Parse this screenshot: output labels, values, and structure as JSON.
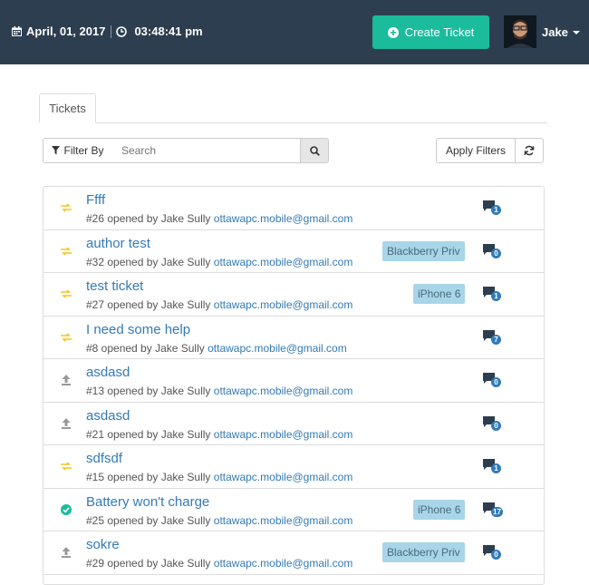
{
  "header": {
    "date": "April, 01, 2017",
    "time": "03:48:41 pm",
    "create_label": "Create Ticket",
    "user_name": "Jake"
  },
  "tabs": [
    {
      "label": "Tickets",
      "active": true
    }
  ],
  "toolbar": {
    "filter_label": "Filter By",
    "search_placeholder": "Search",
    "apply_label": "Apply Filters"
  },
  "tickets": [
    {
      "title": "Ffff",
      "meta": "#26 opened by Jake Sully",
      "email": "ottawapc.mobile@gmail.com",
      "label": "",
      "comments": "1",
      "status": "transfer-icon"
    },
    {
      "title": "author test",
      "meta": "#32 opened by Jake Sully",
      "email": "ottawapc.mobile@gmail.com",
      "label": "Blackberry Priv",
      "comments": "0",
      "status": "transfer-icon"
    },
    {
      "title": "test ticket",
      "meta": "#27 opened by Jake Sully",
      "email": "ottawapc.mobile@gmail.com",
      "label": "iPhone 6",
      "comments": "1",
      "status": "transfer-icon"
    },
    {
      "title": "I need some help",
      "meta": "#8 opened by Jake Sully",
      "email": "ottawapc.mobile@gmail.com",
      "label": "",
      "comments": "7",
      "status": "transfer-icon"
    },
    {
      "title": "asdasd",
      "meta": "#13 opened by Jake Sully",
      "email": "ottawapc.mobile@gmail.com",
      "label": "",
      "comments": "0",
      "status": "upload-icon"
    },
    {
      "title": "asdasd",
      "meta": "#21 opened by Jake Sully",
      "email": "ottawapc.mobile@gmail.com",
      "label": "",
      "comments": "0",
      "status": "upload-icon"
    },
    {
      "title": "sdfsdf",
      "meta": "#15 opened by Jake Sully",
      "email": "ottawapc.mobile@gmail.com",
      "label": "",
      "comments": "1",
      "status": "transfer-icon"
    },
    {
      "title": "Battery won't charge",
      "meta": "#25 opened by Jake Sully",
      "email": "ottawapc.mobile@gmail.com",
      "label": "iPhone 6",
      "comments": "17",
      "status": "check-circle-icon"
    },
    {
      "title": "sokre",
      "meta": "#29 opened by Jake Sully",
      "email": "ottawapc.mobile@gmail.com",
      "label": "Blackberry Priv",
      "comments": "0",
      "status": "upload-icon"
    }
  ],
  "colors": {
    "header_bg": "#2d3e50",
    "accent": "#1abc9c",
    "link": "#337ab7",
    "label_bg": "#a8d5e8",
    "transfer": "#f5c518",
    "upload": "#999999",
    "check": "#1abc9c"
  }
}
